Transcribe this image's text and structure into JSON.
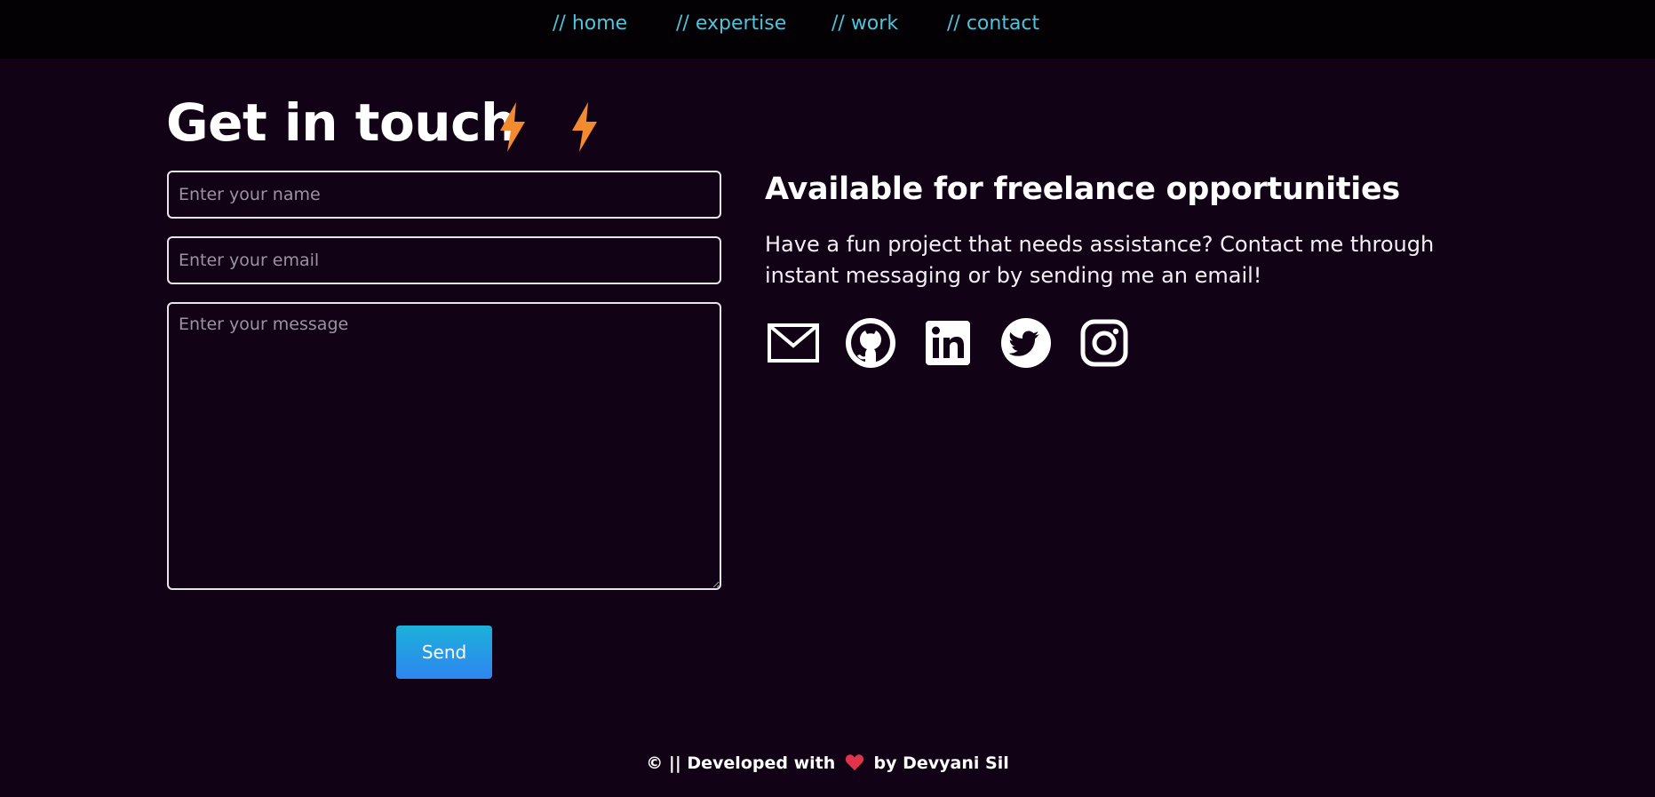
{
  "nav": {
    "items": [
      {
        "label": "// home"
      },
      {
        "label": "// expertise"
      },
      {
        "label": "// work"
      },
      {
        "label": "// contact"
      }
    ],
    "link_color": "#4fc3dc"
  },
  "contact": {
    "title": "Get in touch",
    "name_placeholder": "Enter your name",
    "email_placeholder": "Enter your email",
    "message_placeholder": "Enter your message",
    "send_label": "Send"
  },
  "freelance": {
    "heading": "Available for freelance opportunities",
    "text": "Have a fun project that needs assistance? Contact me through instant messaging or by sending me an email!",
    "socials": [
      {
        "icon": "mail-icon"
      },
      {
        "icon": "github-icon"
      },
      {
        "icon": "linkedin-icon"
      },
      {
        "icon": "twitter-icon"
      },
      {
        "icon": "instagram-icon"
      }
    ]
  },
  "footer": {
    "prefix": "© || Developed with",
    "suffix": "by Devyani Sil"
  },
  "colors": {
    "background": "#120216",
    "accent": "#4fc3dc",
    "bolt": "#f28a30",
    "button_gradient": [
      "#1cb0da",
      "#2e86f0"
    ]
  }
}
